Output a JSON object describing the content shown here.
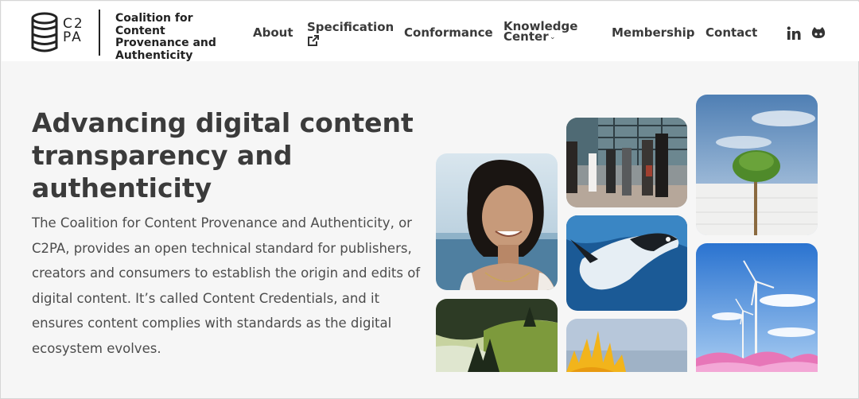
{
  "brand": {
    "logo_text": "C2\nPA",
    "name": "Coalition for Content Provenance and Authenticity"
  },
  "nav": {
    "about": "About",
    "specification": "Specification",
    "conformance": "Conformance",
    "knowledge_center": "Knowledge Center",
    "membership": "Membership",
    "contact": "Contact"
  },
  "social": {
    "linkedin_icon": "linkedin-icon",
    "github_icon": "github-icon"
  },
  "hero": {
    "title": "Advancing digital content transparency and authenticity",
    "body": "The Coalition for Content Provenance and Authenticity, or C2PA, provides an open technical standard for publishers, creators and consumers to establish the origin and edits of digital content. It’s called Content Credentials, and it ensures content complies with standards as the digital ecosystem evolves."
  },
  "colors": {
    "title": "#3b3b3b",
    "body": "#4c4c4c",
    "header_bg": "#ffffff",
    "page_bg": "#f6f6f6"
  }
}
